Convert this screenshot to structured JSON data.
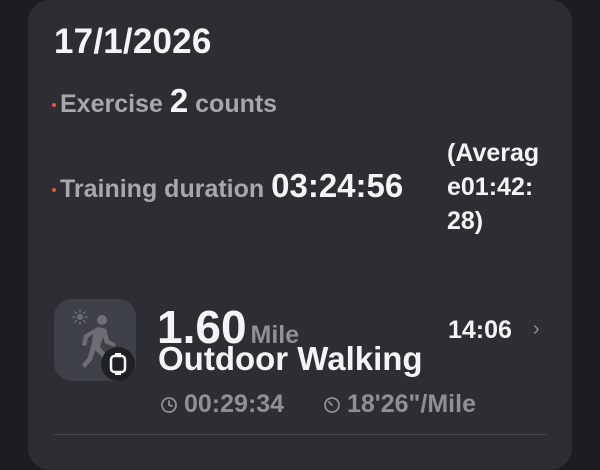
{
  "summary": {
    "date": "17/1/2026",
    "exercise_label": "Exercise",
    "exercise_count": "2",
    "exercise_unit": "counts",
    "training_label": "Training duration",
    "training_duration": "03:24:56",
    "average_text": "(Average01:42:28)"
  },
  "activity": {
    "distance": "1.60",
    "distance_unit": "Mile",
    "name": "Outdoor Walking",
    "start_time": "14:06",
    "duration": "00:29:34",
    "pace": "18'26\"/Mile",
    "icons": [
      "sun-icon",
      "walking-person-icon",
      "watch-icon",
      "chevron-right-icon",
      "clock-icon",
      "speed-gauge-icon"
    ]
  },
  "colors": {
    "background": "#1b1d22",
    "card": "#2c2e34",
    "bullet": "#e2573f",
    "primary_text": "#f4f4f6",
    "secondary_text": "#a6a8ae"
  }
}
